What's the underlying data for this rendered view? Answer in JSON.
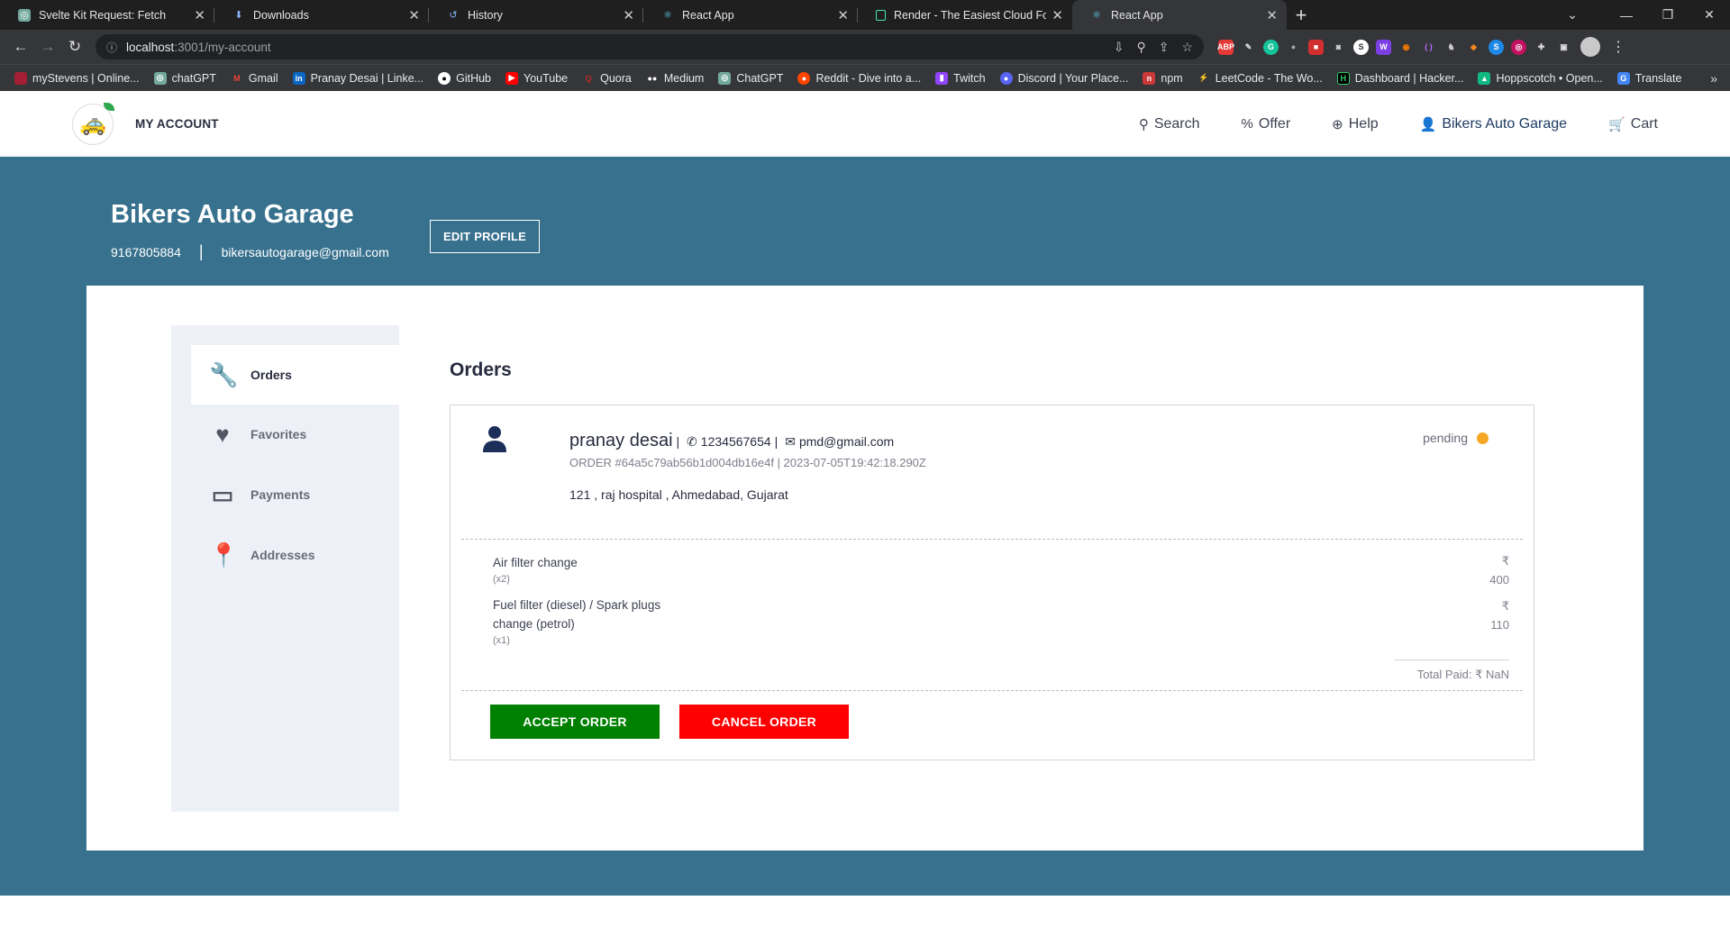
{
  "browser": {
    "tabs": [
      {
        "title": "Svelte Kit Request: Fetch",
        "icon": "openai-icon",
        "active": false
      },
      {
        "title": "Downloads",
        "icon": "download-icon",
        "active": false
      },
      {
        "title": "History",
        "icon": "history-icon",
        "active": false
      },
      {
        "title": "React App",
        "icon": "react-icon",
        "active": false
      },
      {
        "title": "Render - The Easiest Cloud For Al",
        "icon": "render-icon",
        "active": false
      },
      {
        "title": "React App",
        "icon": "react-icon",
        "active": true
      }
    ],
    "url_host": "localhost",
    "url_path": ":3001/my-account",
    "bookmarks": [
      "myStevens | Online...",
      "chatGPT",
      "Gmail",
      "Pranay Desai | Linke...",
      "GitHub",
      "YouTube",
      "Quora",
      "Medium",
      "ChatGPT",
      "Reddit - Dive into a...",
      "Twitch",
      "Discord | Your Place...",
      "npm",
      "LeetCode - The Wo...",
      "Dashboard | Hacker...",
      "Hoppscotch • Open...",
      "Translate"
    ]
  },
  "nav": {
    "brand": "MY ACCOUNT",
    "links": {
      "search": "Search",
      "offer": "Offer",
      "help": "Help",
      "account": "Bikers Auto Garage",
      "cart": "Cart"
    }
  },
  "profile": {
    "name": "Bikers Auto Garage",
    "phone": "9167805884",
    "separator": "|",
    "email": "bikersautogarage@gmail.com",
    "edit_label": "EDIT PROFILE"
  },
  "sidebar": {
    "items": [
      {
        "label": "Orders",
        "icon": "wrench-icon"
      },
      {
        "label": "Favorites",
        "icon": "heart-icon"
      },
      {
        "label": "Payments",
        "icon": "credit-card-icon"
      },
      {
        "label": "Addresses",
        "icon": "location-pin-icon"
      }
    ]
  },
  "orders": {
    "title": "Orders",
    "order": {
      "customer": "pranay desai",
      "phone": "1234567654",
      "email": "pmd@gmail.com",
      "meta_sep": "|",
      "order_line": "ORDER #64a5c79ab56b1d004db16e4f | 2023-07-05T19:42:18.290Z",
      "address": "121 , raj hospital , Ahmedabad, Gujarat",
      "status": "pending",
      "items": [
        {
          "name": "Air filter change",
          "qty": "(x2)",
          "currency": "₹",
          "price": "400"
        },
        {
          "name_line1": "Fuel filter (diesel) / Spark plugs",
          "name_line2": "change (petrol)",
          "qty": "(x1)",
          "currency": "₹",
          "price": "110"
        }
      ],
      "total": "Total Paid: ₹ NaN",
      "accept_label": "ACCEPT ORDER",
      "cancel_label": "CANCEL ORDER"
    }
  },
  "colors": {
    "hero_bg": "#37718e",
    "accept": "#008000",
    "cancel": "#ff0000",
    "pending": "#f5a623"
  }
}
